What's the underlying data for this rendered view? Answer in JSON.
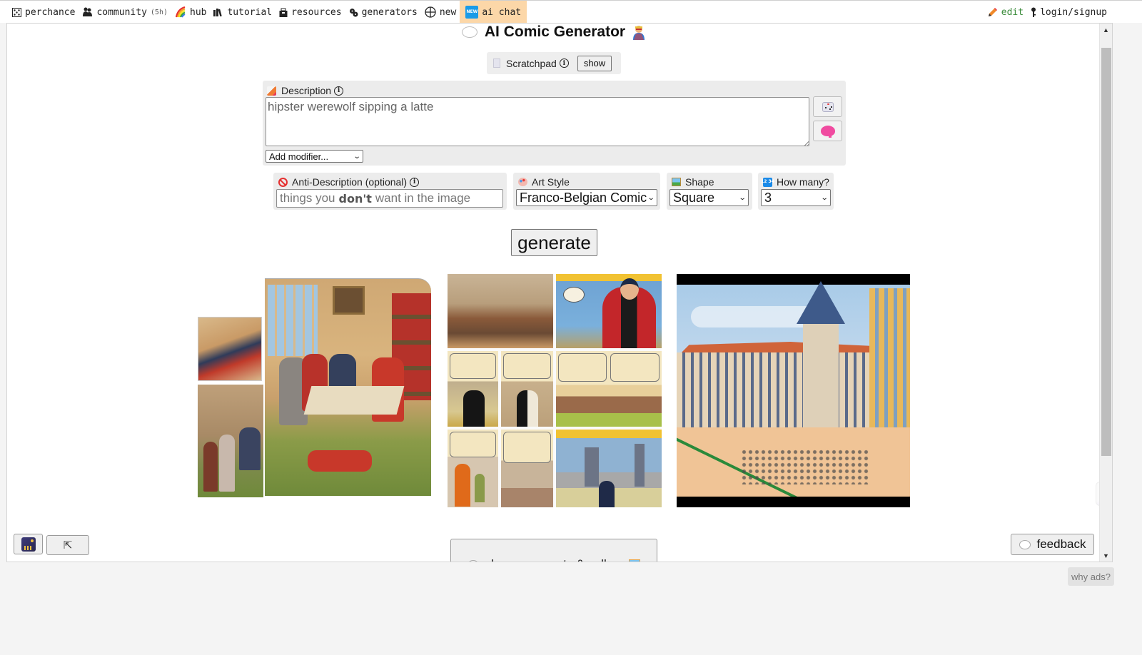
{
  "topnav": {
    "left": [
      {
        "id": "perchance",
        "label": "perchance",
        "icon": "die-icon"
      },
      {
        "id": "community",
        "label": "community",
        "sub": "(5h)",
        "icon": "people-icon"
      },
      {
        "id": "hub",
        "label": "hub",
        "icon": "rainbow-icon"
      },
      {
        "id": "tutorial",
        "label": "tutorial",
        "icon": "books-icon"
      },
      {
        "id": "resources",
        "label": "resources",
        "icon": "toolbox-icon"
      },
      {
        "id": "generators",
        "label": "generators",
        "icon": "gears-icon"
      },
      {
        "id": "new",
        "label": "new",
        "icon": "globe-plus-icon"
      },
      {
        "id": "ai-chat",
        "label": "ai chat",
        "icon": "new-badge-icon",
        "badge": "NEW",
        "highlighted": true
      }
    ],
    "right": [
      {
        "id": "edit",
        "label": "edit",
        "icon": "pencil-icon"
      },
      {
        "id": "login",
        "label": "login/signup",
        "icon": "key-icon"
      }
    ],
    "highlight_color": "#fcd7a8",
    "edit_color": "#3a8b3a"
  },
  "page": {
    "title": "AI Comic Generator",
    "scratchpad": {
      "label": "Scratchpad",
      "button": "show"
    },
    "description": {
      "label": "Description",
      "value": "hipster werewolf sipping a latte",
      "modifier_select": "Add modifier..."
    },
    "anti_description": {
      "label": "Anti-Description (optional)",
      "placeholder_before": "things you",
      "placeholder_bold": "don't",
      "placeholder_after": "want in the image"
    },
    "art_style": {
      "label": "Art Style",
      "value": "Franco-Belgian Comic"
    },
    "shape": {
      "label": "Shape",
      "value": "Square"
    },
    "how_many": {
      "label": "How many?",
      "value": "3"
    },
    "generate_button": "generate",
    "images": [
      {
        "alt": "generated comic image 1 - group around a table in library"
      },
      {
        "alt": "generated comic image 2 - multi-panel comic page"
      },
      {
        "alt": "generated comic image 3 - town square with tower"
      }
    ],
    "bottom": {
      "back_to_top": "⇱",
      "comments_button": "show comments & gallery",
      "feedback_button": "feedback",
      "chat_tab": ">ˬ<"
    }
  },
  "footer": {
    "why_ads": "why ads?"
  }
}
